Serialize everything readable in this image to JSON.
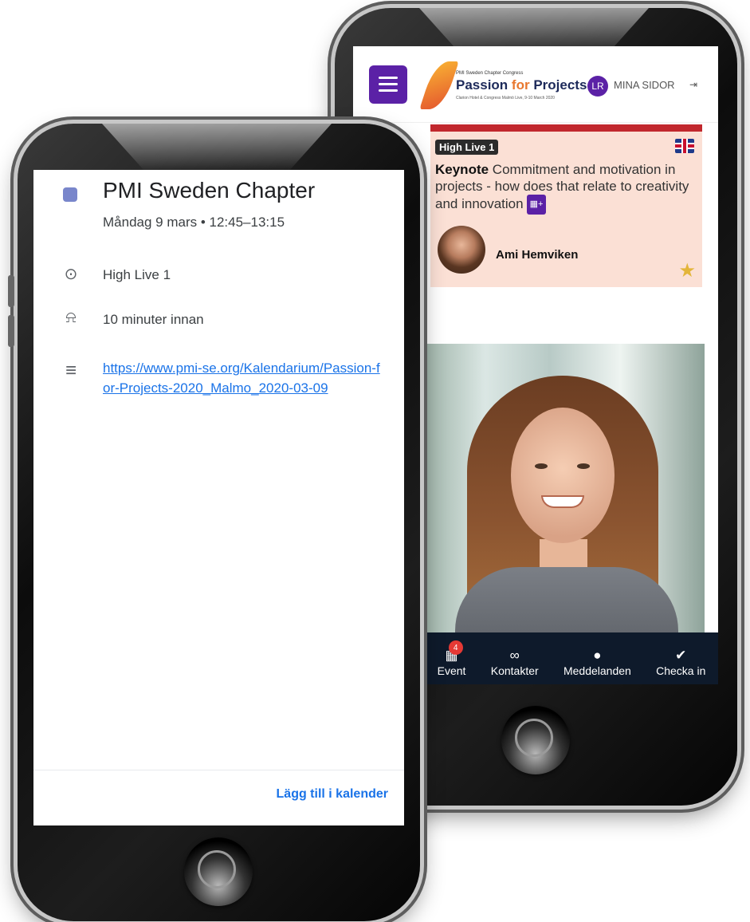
{
  "back_phone": {
    "header": {
      "logo_small": "PMI Sweden Chapter Congress",
      "logo_main_a": "Passion ",
      "logo_main_for": "for",
      "logo_main_b": " Projects",
      "logo_sub": "Clarion Hotel & Congress Malmö Live, 9-10 March 2020",
      "avatar_initials": "LR",
      "account_link": "MINA SIDOR"
    },
    "session": {
      "room": "High Live 1",
      "type": "Keynote",
      "title": " Commitment and motivation in projects - how does that relate to creativity and innovation",
      "add_calendar": "▦+",
      "speaker": "Ami Hemviken"
    },
    "nav": [
      {
        "label": "Event",
        "icon": "calendar-icon",
        "badge": "4"
      },
      {
        "label": "Kontakter",
        "icon": "link-icon"
      },
      {
        "label": "Meddelanden",
        "icon": "chat-icon"
      },
      {
        "label": "Checka in",
        "icon": "check-icon"
      }
    ]
  },
  "front_phone": {
    "event_title": "PMI Sweden Chapter",
    "event_time": "Måndag 9 mars  •  12:45–13:15",
    "location": "High Live 1",
    "reminder": "10 minuter innan",
    "link": "https://www.pmi-se.org/Kalendarium/Passion-for-Projects-2020_Malmo_2020-03-09",
    "add_button": "Lägg till i kalender"
  },
  "colors": {
    "brand_purple": "#5b21a6",
    "card_bg": "#fbe0d5",
    "card_accent": "#c1272d",
    "nav_bg": "#0e1a2b",
    "google_blue": "#1a73e8",
    "event_color": "#7986cb"
  }
}
